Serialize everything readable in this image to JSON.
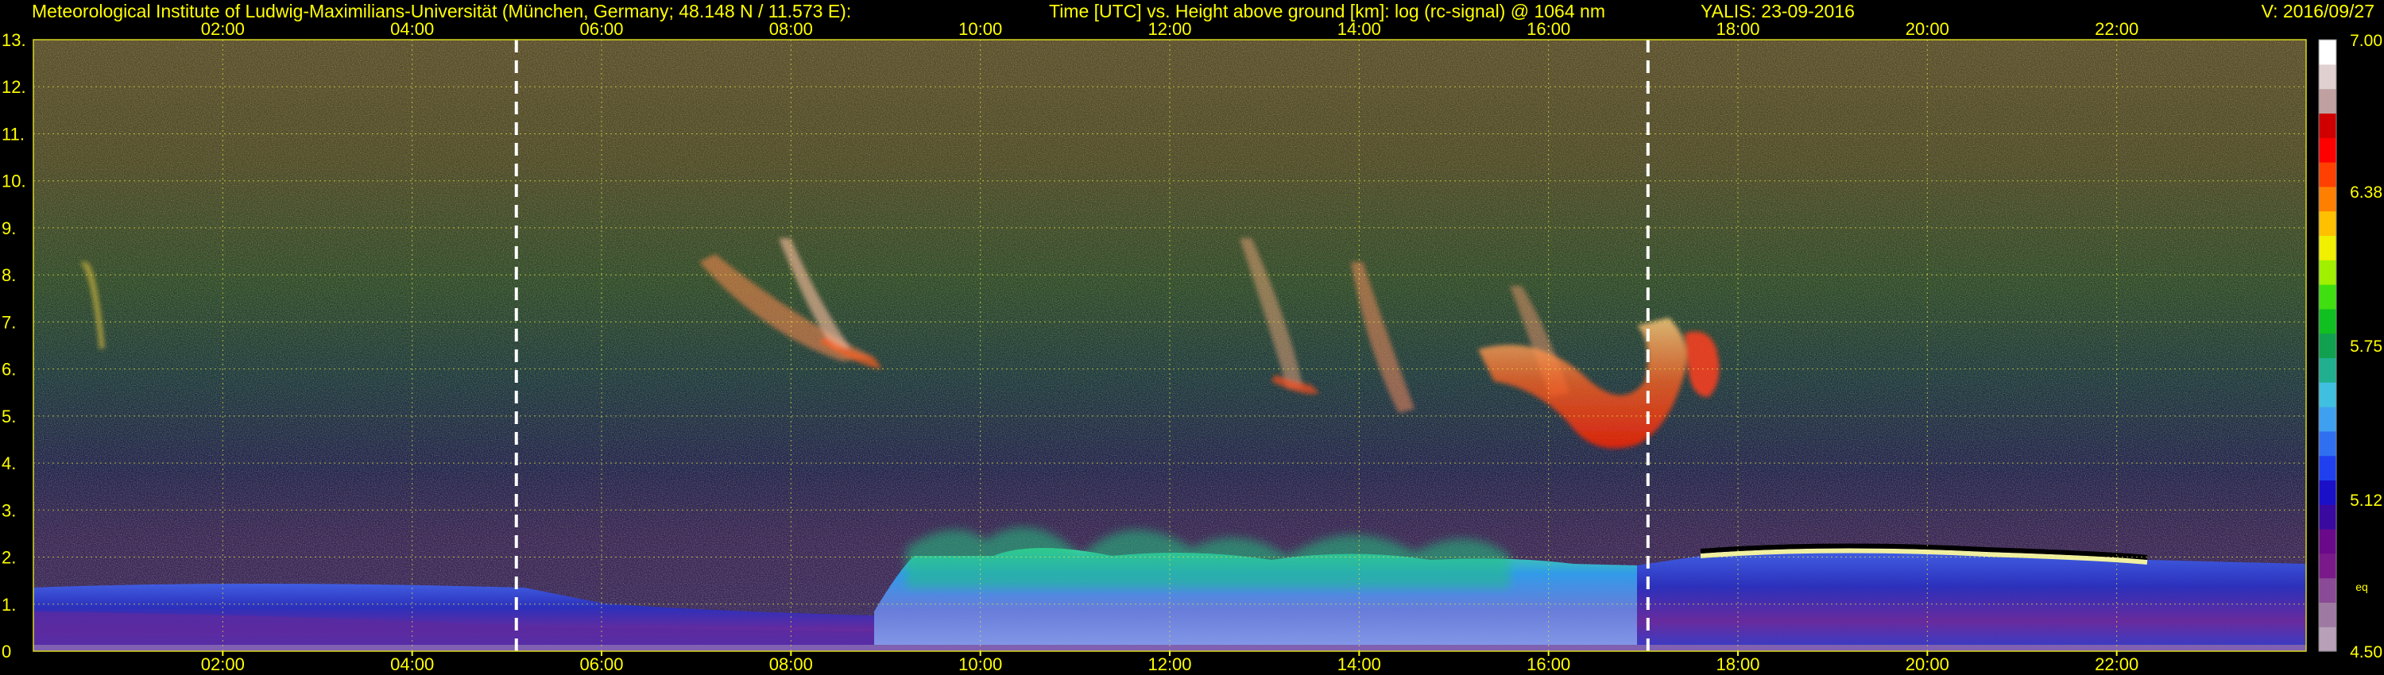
{
  "header": {
    "institute": "Meteorological Institute of Ludwig-Maximilians-Universität (München, Germany; 48.148 N / 11.573 E):",
    "description": "Time [UTC] vs. Height above ground [km]: log (rc-signal) @ 1064 nm",
    "instrument_date": "YALIS: 23-09-2016",
    "version": "V: 2016/09/27"
  },
  "chart_data": {
    "type": "heatmap",
    "x_ticks": [
      "02:00",
      "04:00",
      "06:00",
      "08:00",
      "10:00",
      "12:00",
      "14:00",
      "16:00",
      "18:00",
      "20:00",
      "22:00"
    ],
    "x_tick_hours": [
      2,
      4,
      6,
      8,
      10,
      12,
      14,
      16,
      18,
      20,
      22
    ],
    "xlim_hours": [
      0,
      24
    ],
    "y_ticks": [
      "0",
      "1.",
      "2.",
      "3.",
      "4.",
      "5.",
      "6.",
      "7.",
      "8.",
      "9.",
      "10.",
      "11.",
      "12.",
      "13."
    ],
    "y_tick_values": [
      0,
      1,
      2,
      3,
      4,
      5,
      6,
      7,
      8,
      9,
      10,
      11,
      12,
      13
    ],
    "ylim_km": [
      0,
      13
    ],
    "grid": true,
    "vertical_markers_hours": [
      5.1,
      17.05
    ],
    "colorbar": {
      "range": [
        4.5,
        7.0
      ],
      "labels": [
        "7.00",
        "6.38",
        "5.75",
        "5.12",
        "4.50"
      ],
      "label_values": [
        7.0,
        6.38,
        5.75,
        5.12,
        4.5
      ],
      "extra_label": "eq",
      "colors": [
        "#b8a0b8",
        "#9e7aa3",
        "#8a4a95",
        "#7a1a8a",
        "#6a0a8a",
        "#3a0aa0",
        "#1a10c8",
        "#2040f0",
        "#3070f0",
        "#40a0f0",
        "#40c0e0",
        "#20b090",
        "#10a050",
        "#10c020",
        "#40e010",
        "#a0f000",
        "#f0f000",
        "#ffc000",
        "#ff8000",
        "#ff4000",
        "#ff0000",
        "#d00000",
        "#c0a0a0",
        "#e0d0d0",
        "#ffffff"
      ]
    }
  },
  "colors": {
    "text": "#ffff00",
    "background": "#000000",
    "grid": "#e6e640",
    "marker": "#ffffff",
    "frame": "#d8d820"
  }
}
